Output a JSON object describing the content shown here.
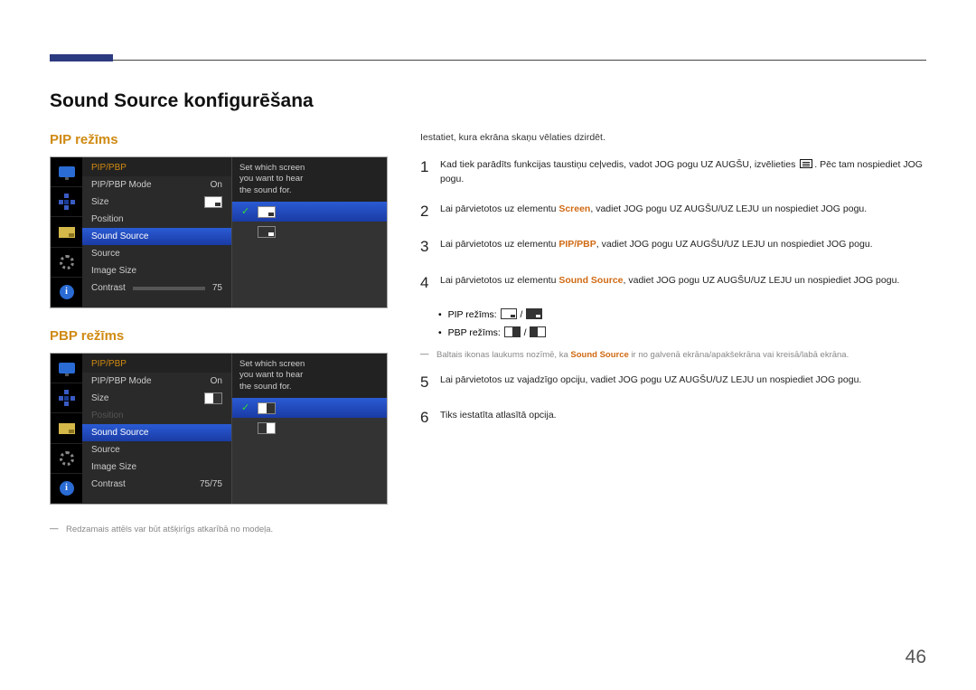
{
  "page_title": "Sound Source konfigurēšana",
  "page_number": "46",
  "modes": {
    "pip_label": "PIP režīms",
    "pbp_label": "PBP režīms"
  },
  "osd_common": {
    "menu_title": "PIP/PBP",
    "desc_line1": "Set which screen",
    "desc_line2": "you want to hear",
    "desc_line3": "the sound for.",
    "items": {
      "mode": "PIP/PBP Mode",
      "mode_val": "On",
      "size": "Size",
      "position": "Position",
      "sound_source": "Sound Source",
      "source": "Source",
      "image_size": "Image Size",
      "contrast": "Contrast"
    },
    "contrast_pip": "75",
    "contrast_pbp": "75/75"
  },
  "right": {
    "intro": "Iestatiet, kura ekrāna skaņu vēlaties dzirdēt.",
    "step1_pre": "Kad tiek parādīts funkcijas taustiņu ceļvedis, vadot JOG pogu UZ AUGŠU, izvēlieties ",
    "step1_post": ". Pēc tam nospiediet JOG pogu.",
    "step2_pre": "Lai pārvietotos uz elementu ",
    "step2_hl": "Screen",
    "step2_post": ", vadiet JOG pogu UZ AUGŠU/UZ LEJU un nospiediet JOG pogu.",
    "step3_pre": "Lai pārvietotos uz elementu ",
    "step3_hl": "PIP/PBP",
    "step3_post": ", vadiet JOG pogu UZ AUGŠU/UZ LEJU un nospiediet JOG pogu.",
    "step4_pre": "Lai pārvietotos uz elementu ",
    "step4_hl": "Sound Source",
    "step4_post": ", vadiet JOG pogu UZ AUGŠU/UZ LEJU un nospiediet JOG pogu.",
    "bullet_pip": "PIP režīms: ",
    "bullet_pbp": "PBP režīms: ",
    "hint_pre": "Baltais ikonas laukums nozīmē, ka ",
    "hint_hl": "Sound Source",
    "hint_post": " ir no galvenā ekrāna/apakšekrāna vai kreisā/labā ekrāna.",
    "step5": "Lai pārvietotos uz vajadzīgo opciju, vadiet JOG pogu UZ AUGŠU/UZ LEJU un nospiediet JOG pogu.",
    "step6": "Tiks iestatīta atlasītā opcija."
  },
  "footnote": "Redzamais attēls var būt atšķirīgs atkarībā no modeļa."
}
